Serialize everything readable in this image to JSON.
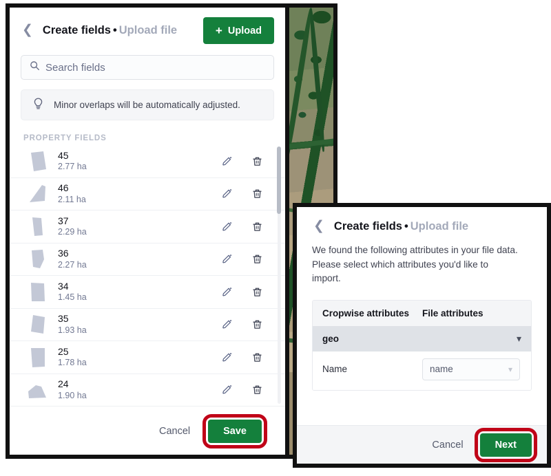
{
  "left_panel": {
    "back_icon": "chevron-left-icon",
    "breadcrumb": {
      "primary": "Create fields",
      "separator": "•",
      "secondary": "Upload file"
    },
    "upload_button": {
      "plus": "+",
      "label": "Upload"
    },
    "search": {
      "icon": "search-icon",
      "placeholder": "Search fields"
    },
    "hint": {
      "icon": "lightbulb-icon",
      "text": "Minor overlaps will be automatically adjusted."
    },
    "section_label": "PROPERTY FIELDS",
    "row_icons": {
      "edit": "pencil-icon",
      "delete": "trash-icon"
    },
    "fields": [
      {
        "name": "45",
        "area": "2.77 ha"
      },
      {
        "name": "46",
        "area": "2.11 ha"
      },
      {
        "name": "37",
        "area": "2.29 ha"
      },
      {
        "name": "36",
        "area": "2.27 ha"
      },
      {
        "name": "34",
        "area": "1.45 ha"
      },
      {
        "name": "35",
        "area": "1.93 ha"
      },
      {
        "name": "25",
        "area": "1.78 ha"
      },
      {
        "name": "24",
        "area": "1.90 ha"
      }
    ],
    "footer": {
      "cancel_label": "Cancel",
      "save_label": "Save"
    }
  },
  "right_panel": {
    "back_icon": "chevron-left-icon",
    "breadcrumb": {
      "primary": "Create fields",
      "separator": "•",
      "secondary": "Upload file"
    },
    "description": "We found the following attributes in your file data. Please select which attributes you'd like to import.",
    "table": {
      "headers": [
        "Cropwise attributes",
        "File attributes"
      ],
      "group": {
        "label": "geo",
        "chevron": "chevron-down-icon"
      },
      "rows": [
        {
          "label": "Name",
          "value": "name",
          "chevron": "chevron-down-icon"
        }
      ]
    },
    "footer": {
      "cancel_label": "Cancel",
      "next_label": "Next"
    }
  },
  "map": {
    "alt": "satellite-imagery-strip"
  },
  "colors": {
    "brand_green": "#14803c",
    "annotation_red": "#c00418",
    "muted_text": "#a3a9b9",
    "panel_border": "#111111"
  }
}
